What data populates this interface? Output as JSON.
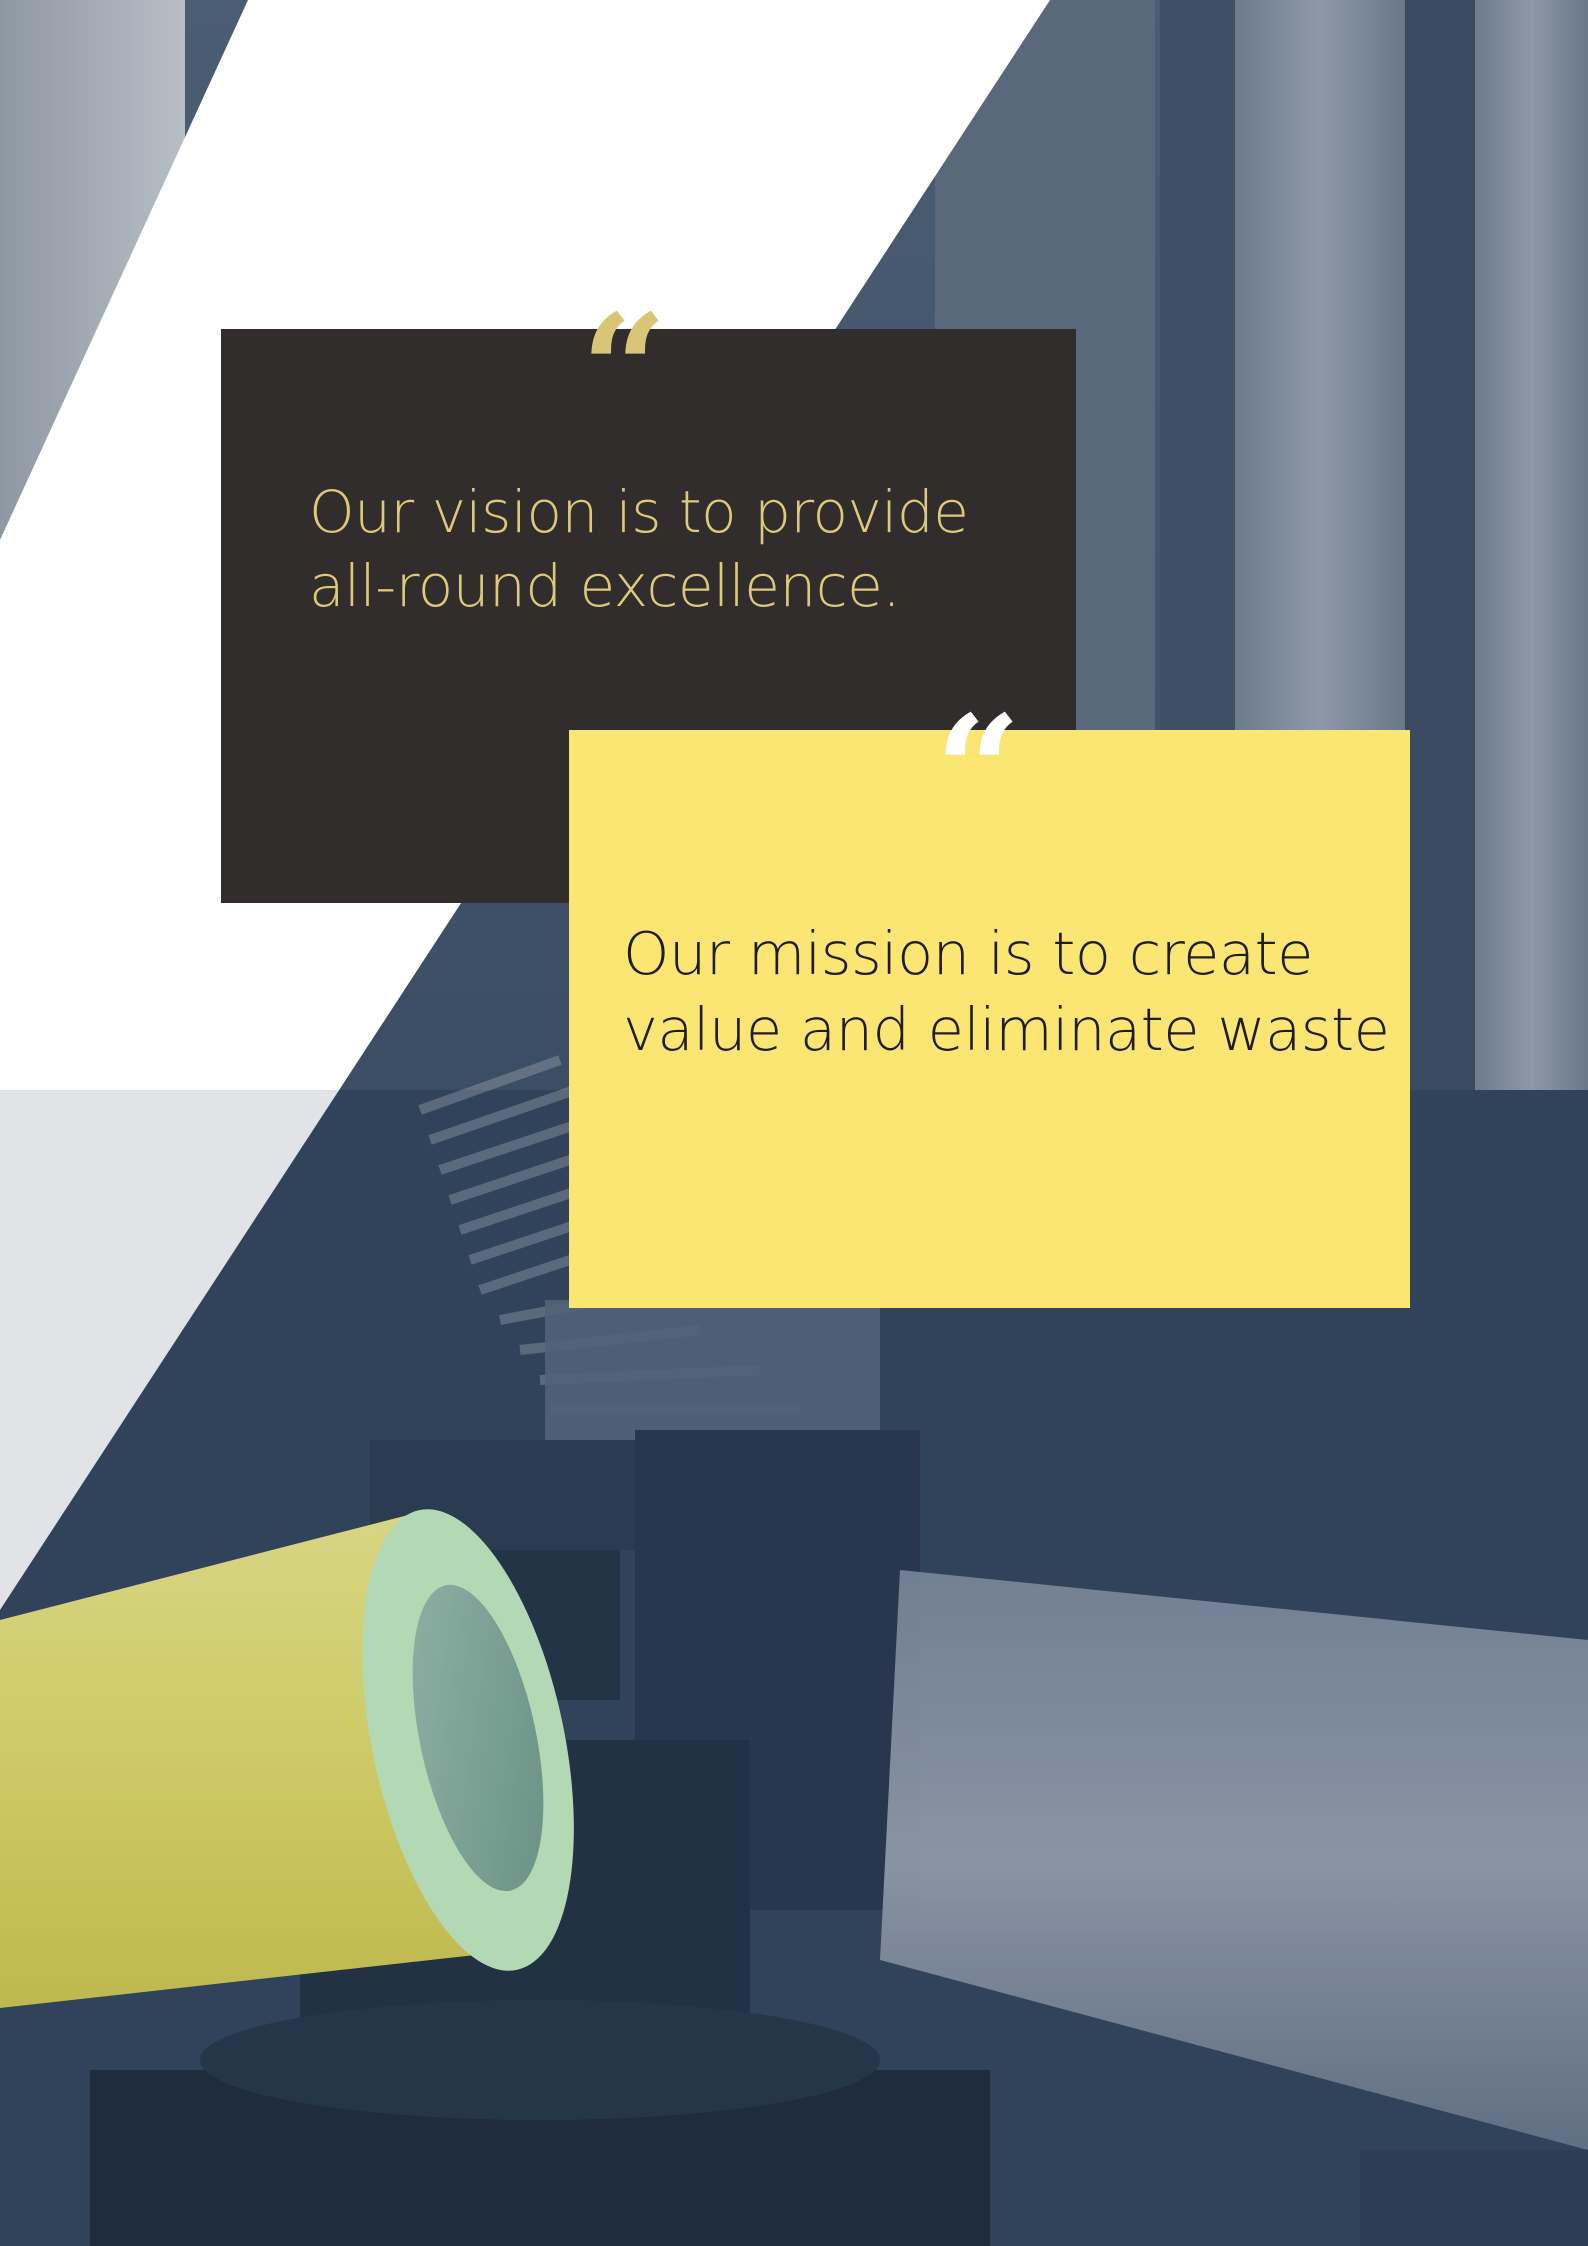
{
  "vision": {
    "quote_mark": "“",
    "text": "Our vision is to provide\nall-round excellence."
  },
  "mission": {
    "quote_mark": "“",
    "text": "Our mission is to create\nvalue and eliminate waste"
  },
  "colors": {
    "vision_background": "#312d2d",
    "vision_text": "#ddc979",
    "mission_background": "#fbe573",
    "mission_text": "#1f1d1a",
    "accent_yellow": "#f2ea6e",
    "photo_tint": "#33465c"
  }
}
